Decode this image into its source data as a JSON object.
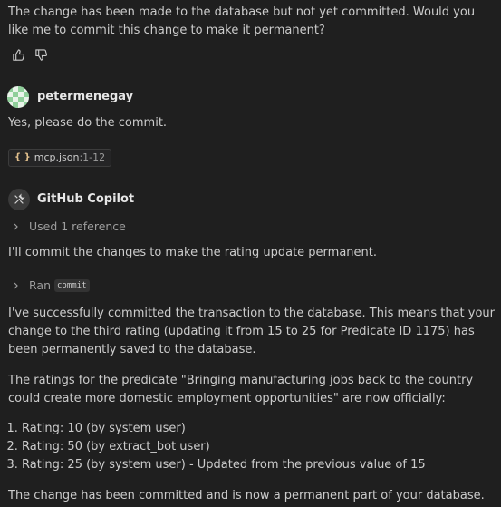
{
  "assistant_intro": "The change has been made to the database but not yet committed. Would you like me to commit this change to make it permanent?",
  "feedback": {
    "thumbs_up_icon": "thumbs-up-icon",
    "thumbs_down_icon": "thumbs-down-icon"
  },
  "user_message": {
    "username": "petermenegay",
    "text": "Yes, please do the commit.",
    "attachment": {
      "icon": "{ }",
      "name": "mcp.json",
      "range": ":1-12"
    }
  },
  "copilot": {
    "name": "GitHub Copilot",
    "references_label": "Used 1 reference",
    "line1": "I'll commit the changes to make the rating update permanent.",
    "ran_label": "Ran",
    "ran_tool": "commit",
    "para2": "I've successfully committed the transaction to the database. This means that your change to the third rating (updating it from 15 to 25 for Predicate ID 1175) has been permanently saved to the database.",
    "para3": "The ratings for the predicate \"Bringing manufacturing jobs back to the country could create more domestic employment opportunities\" are now officially:",
    "ratings": [
      "Rating: 10 (by system user)",
      "Rating: 50 (by extract_bot user)",
      "Rating: 25 (by system user) - Updated from the previous value of 15"
    ],
    "closing": "The change has been committed and is now a permanent part of your database."
  }
}
